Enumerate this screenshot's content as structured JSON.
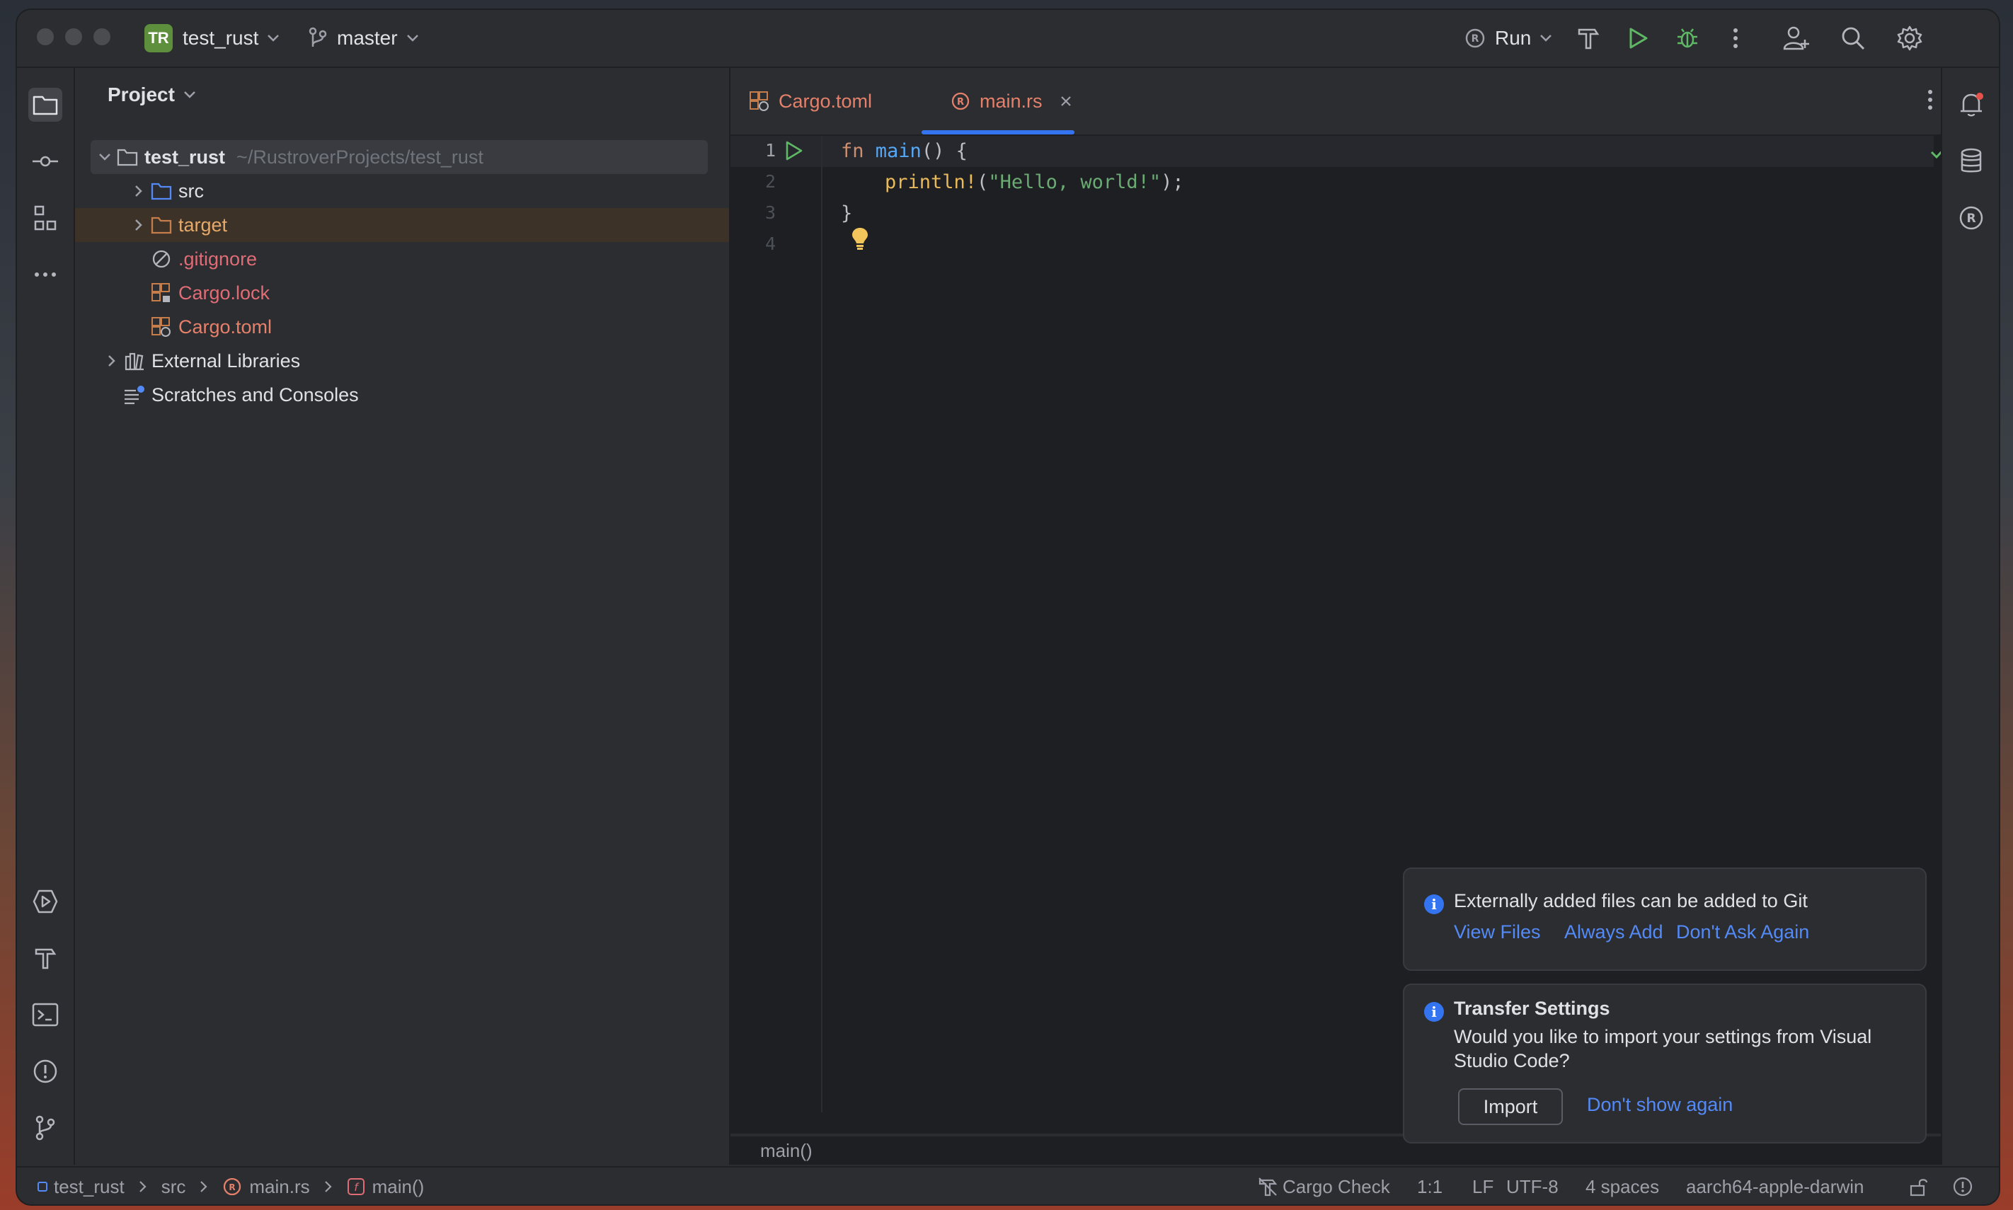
{
  "titlebar": {
    "project_badge": "TR",
    "project_name": "test_rust",
    "branch": "master",
    "run_config": "Run"
  },
  "project_panel": {
    "title": "Project",
    "root_name": "test_rust",
    "root_path": "~/RustroverProjects/test_rust",
    "items": [
      {
        "label": "src"
      },
      {
        "label": "target"
      },
      {
        "label": ".gitignore"
      },
      {
        "label": "Cargo.lock"
      },
      {
        "label": "Cargo.toml"
      },
      {
        "label": "External Libraries"
      },
      {
        "label": "Scratches and Consoles"
      }
    ]
  },
  "tabs": [
    {
      "label": "Cargo.toml"
    },
    {
      "label": "main.rs",
      "active": true
    }
  ],
  "editor": {
    "line_numbers": [
      "1",
      "2",
      "3",
      "4"
    ],
    "code": {
      "l1_kw": "fn",
      "l1_fn": "main",
      "l1_rest": "() {",
      "l2_macro": "println!",
      "l2_open": "(",
      "l2_str": "\"Hello, world!\"",
      "l2_close": ");",
      "l3": "}"
    },
    "breadcrumb": "main()"
  },
  "notifications": {
    "git": {
      "message": "Externally added files can be added to Git",
      "actions": [
        "View Files",
        "Always Add",
        "Don't Ask Again"
      ]
    },
    "transfer": {
      "title": "Transfer Settings",
      "message_line1": "Would you like to import your settings from Visual",
      "message_line2": "Studio Code?",
      "import_button": "Import",
      "dismiss_link": "Don't show again"
    }
  },
  "statusbar": {
    "crumbs": [
      "test_rust",
      "src",
      "main.rs",
      "main()"
    ],
    "cargo_check": "Cargo Check",
    "position": "1:1",
    "line_ending": "LF",
    "encoding": "UTF-8",
    "indent": "4 spaces",
    "target": "aarch64-apple-darwin"
  },
  "colors": {
    "accent": "#3574f0",
    "ignored_file": "#e06c75",
    "modified_file": "#e5806b",
    "run_green": "#5fb865"
  }
}
